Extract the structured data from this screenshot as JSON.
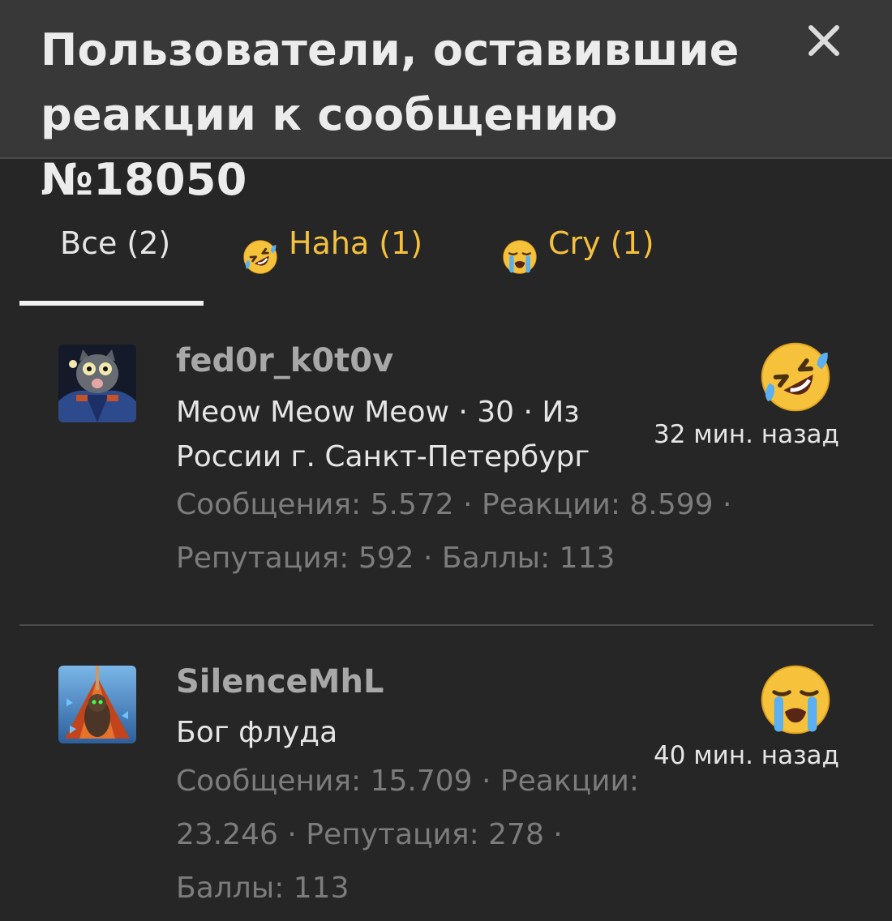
{
  "header": {
    "title": "Пользователи, оставившие реакции к сообщению №18050",
    "close_icon": "close-icon"
  },
  "tabs": [
    {
      "label": "Все (2)",
      "icon": null,
      "active": true
    },
    {
      "label": "Haha (1)",
      "icon": "haha-emoji-icon",
      "active": false
    },
    {
      "label": "Cry (1)",
      "icon": "cry-emoji-icon",
      "active": false
    }
  ],
  "reactions": [
    {
      "username": "fed0r_k0t0v",
      "user_title": "Meow Meow Meow · 30 · Из России г. Санкт-Петербург",
      "stats": "Сообщения: 5.572 · Реакции: 8.599 · Репутация: 592 · Баллы: 113",
      "reaction_icon": "haha-emoji-icon",
      "time": "32 мин. назад"
    },
    {
      "username": "SilenceMhL",
      "user_title": "Бог флуда",
      "stats": "Сообщения: 15.709 · Реакции: 23.246 · Репутация: 278 · Баллы: 113",
      "reaction_icon": "cry-emoji-icon",
      "time": "40 мин. назад"
    }
  ],
  "colors": {
    "background": "#262626",
    "header_bg": "#383838",
    "accent": "#f5c13c",
    "muted_text": "#7c7c7c",
    "username": "#a8a8a8"
  }
}
